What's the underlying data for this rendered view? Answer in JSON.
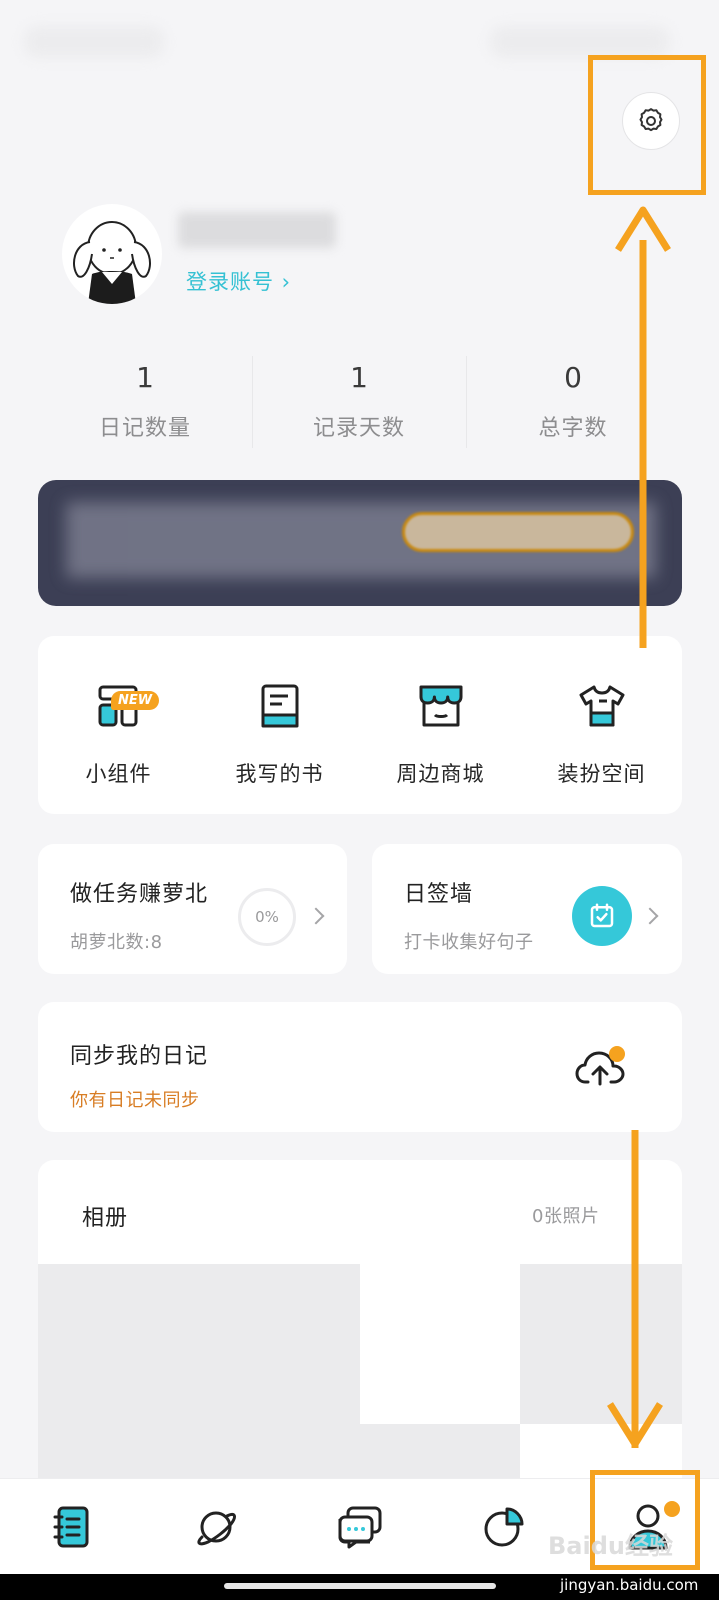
{
  "profile": {
    "login_label": "登录账号 ›"
  },
  "stats": [
    {
      "value": "1",
      "label": "日记数量"
    },
    {
      "value": "1",
      "label": "记录天数"
    },
    {
      "value": "0",
      "label": "总字数"
    }
  ],
  "tools": [
    {
      "label": "小组件",
      "icon": "widget-icon",
      "badge": "NEW"
    },
    {
      "label": "我写的书",
      "icon": "book-icon"
    },
    {
      "label": "周边商城",
      "icon": "shop-icon"
    },
    {
      "label": "装扮空间",
      "icon": "shirt-icon"
    }
  ],
  "tasks": {
    "title": "做任务赚萝北",
    "subtitle": "胡萝北数:8",
    "progress_label": "0%",
    "progress": 0
  },
  "signin": {
    "title": "日签墙",
    "subtitle": "打卡收集好句子",
    "icon": "calendar-check-icon"
  },
  "sync": {
    "title": "同步我的日记",
    "subtitle": "你有日记未同步",
    "icon": "cloud-upload-icon"
  },
  "album": {
    "title": "相册",
    "count": "0张照片"
  },
  "nav": [
    {
      "name": "diary",
      "icon": "notebook-icon"
    },
    {
      "name": "planet",
      "icon": "planet-icon"
    },
    {
      "name": "messages",
      "icon": "chat-icon"
    },
    {
      "name": "stats",
      "icon": "pie-chart-icon"
    },
    {
      "name": "me",
      "icon": "person-icon",
      "active": true
    }
  ],
  "watermark": {
    "brand": "Baidu经验",
    "url": "jingyan.baidu.com"
  },
  "colors": {
    "accent": "#35c1d3",
    "annotation": "#f5a21f",
    "warning": "#d87d24",
    "banner_bg": "#3c3f55"
  }
}
